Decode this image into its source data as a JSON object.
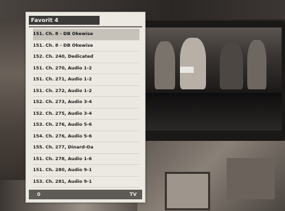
{
  "menu": {
    "title": "Favorit 4",
    "footer_left": "0",
    "footer_right": "TV",
    "items": [
      "151. Ch. 8 - DB Okewise",
      "151. Ch. 8 - DB Okewise",
      "152. Ch. 240, Dedicated",
      "151. Ch. 270, Audio 1-2",
      "151. Ch. 271, Audio 1-2",
      "151. Ch. 272, Audio 1-2",
      "152. Ch. 273, Audio 3-4",
      "152. Ch. 275, Audio 3-4",
      "153. Ch. 276, Audio 5-6",
      "154. Ch. 276, Audio 5-6",
      "155. Ch. 277, Dinard-Oa",
      "151. Ch. 278, Audio 1-6",
      "151. Ch. 280, Audio 9-1",
      "153. Ch. 281, Audio 9-1"
    ],
    "selected_index": 0
  },
  "colors": {
    "menu_bg": "#ece9e3",
    "title_bg": "#3c3a38",
    "selected_bg": "#c6c1b9",
    "footer_bg": "#5e5a55"
  }
}
